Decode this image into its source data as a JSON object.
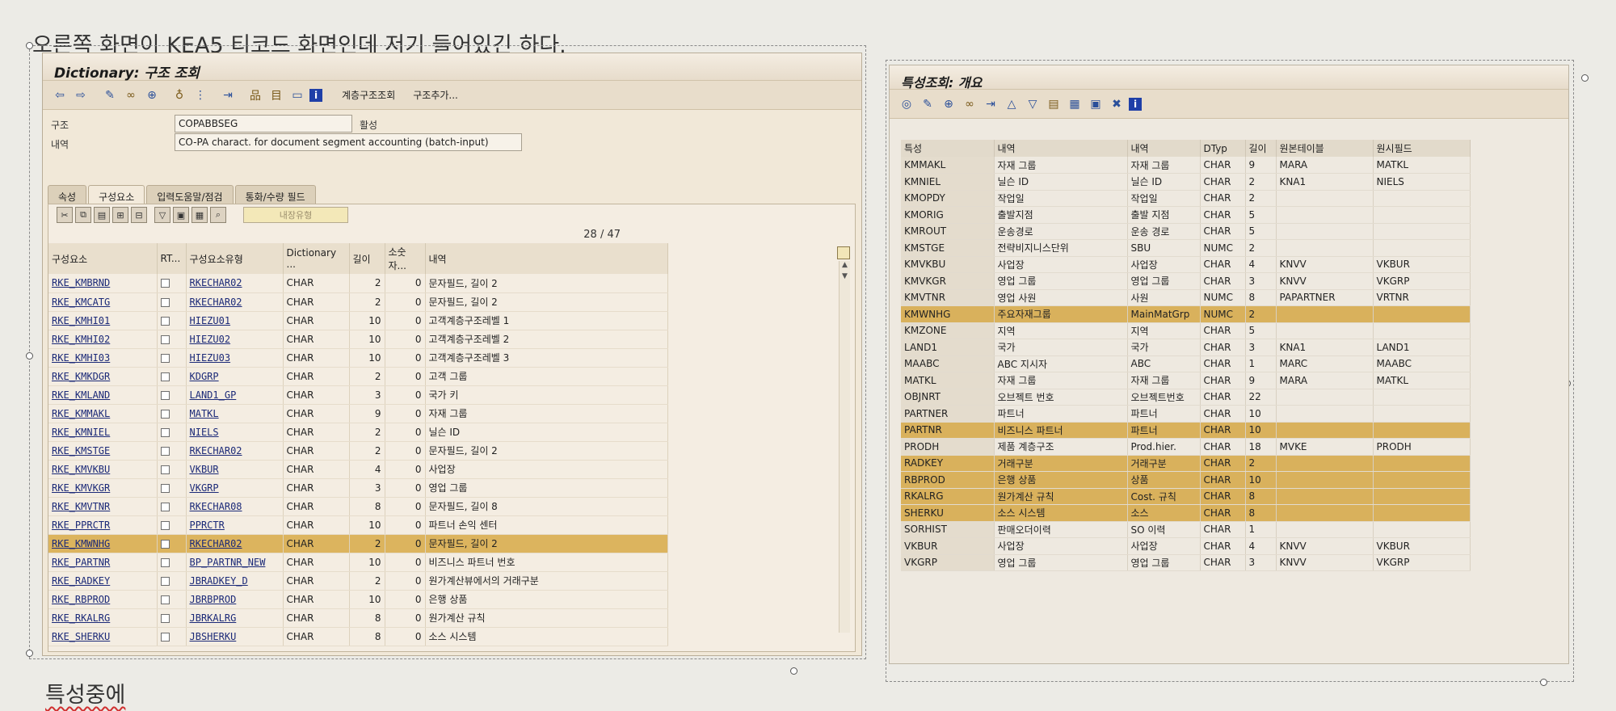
{
  "doc": {
    "top_note": "오른쪽 화면이 KEA5 티코드 화면인데 저기 들어있긴 하다.",
    "bottom_note": "특성중에"
  },
  "left": {
    "title": "Dictionary: 구조 조회",
    "toolbar_icons": [
      "back-icon",
      "forward-icon",
      "pencil-icon",
      "glasses-icon",
      "display-change-icon",
      "where-used-icon",
      "hierarchy-icon",
      "activate-icon",
      "tree-icon",
      "layout-icon",
      "window-icon",
      "info-icon"
    ],
    "toolbar_text": [
      "계층구조조회",
      "구조추가..."
    ],
    "structure_label": "구조",
    "structure_value": "COPABBSEG",
    "structure_status": "활성",
    "desc_label": "내역",
    "desc_value": "CO-PA charact. for document segment accounting (batch-input)",
    "tabs": [
      "속성",
      "구성요소",
      "입력도움말/점검",
      "통화/수량 필드"
    ],
    "disabled_button": "내장유형",
    "pager": "28 / 47",
    "headers": [
      "구성요소",
      "RT...",
      "구성요소유형",
      "Dictionary ...",
      "길이",
      "소숫자...",
      "내역"
    ],
    "rows": [
      [
        "RKE_KMBRND",
        "RKECHAR02",
        "CHAR",
        "2",
        "0",
        "문자필드, 길이 2"
      ],
      [
        "RKE_KMCATG",
        "RKECHAR02",
        "CHAR",
        "2",
        "0",
        "문자필드, 길이 2"
      ],
      [
        "RKE_KMHI01",
        "HIEZU01",
        "CHAR",
        "10",
        "0",
        "고객계층구조레벨 1"
      ],
      [
        "RKE_KMHI02",
        "HIEZU02",
        "CHAR",
        "10",
        "0",
        "고객계층구조레벨 2"
      ],
      [
        "RKE_KMHI03",
        "HIEZU03",
        "CHAR",
        "10",
        "0",
        "고객계층구조레벨 3"
      ],
      [
        "RKE_KMKDGR",
        "KDGRP",
        "CHAR",
        "2",
        "0",
        "고객 그룹"
      ],
      [
        "RKE_KMLAND",
        "LAND1_GP",
        "CHAR",
        "3",
        "0",
        "국가 키"
      ],
      [
        "RKE_KMMAKL",
        "MATKL",
        "CHAR",
        "9",
        "0",
        "자재 그룹"
      ],
      [
        "RKE_KMNIEL",
        "NIELS",
        "CHAR",
        "2",
        "0",
        "닐슨 ID"
      ],
      [
        "RKE_KMSTGE",
        "RKECHAR02",
        "CHAR",
        "2",
        "0",
        "문자필드, 길이 2"
      ],
      [
        "RKE_KMVKBU",
        "VKBUR",
        "CHAR",
        "4",
        "0",
        "사업장"
      ],
      [
        "RKE_KMVKGR",
        "VKGRP",
        "CHAR",
        "3",
        "0",
        "영업 그룹"
      ],
      [
        "RKE_KMVTNR",
        "RKECHAR08",
        "CHAR",
        "8",
        "0",
        "문자필드, 길이 8"
      ],
      [
        "RKE_PPRCTR",
        "PPRCTR",
        "CHAR",
        "10",
        "0",
        "파트너 손익 센터"
      ],
      [
        "RKE_KMWNHG",
        "RKECHAR02",
        "CHAR",
        "2",
        "0",
        "문자필드, 길이 2"
      ],
      [
        "RKE_PARTNR",
        "BP_PARTNR_NEW",
        "CHAR",
        "10",
        "0",
        "비즈니스 파트너 번호"
      ],
      [
        "RKE_RADKEY",
        "JBRADKEY_D",
        "CHAR",
        "2",
        "0",
        "원가계산뷰에서의 거래구분"
      ],
      [
        "RKE_RBPROD",
        "JBRBPROD",
        "CHAR",
        "10",
        "0",
        "은행 상품"
      ],
      [
        "RKE_RKALRG",
        "JBRKALRG",
        "CHAR",
        "8",
        "0",
        "원가계산 규칙"
      ],
      [
        "RKE_SHERKU",
        "JBSHERKU",
        "CHAR",
        "8",
        "0",
        "소스 시스템"
      ]
    ],
    "highlight_row": 14
  },
  "right": {
    "title": "특성조회: 개요",
    "toolbar_icons": [
      "display-icon",
      "pencil-icon",
      "change-icon",
      "glasses-icon",
      "create-icon",
      "sort-icon",
      "filter-icon",
      "export-icon",
      "layout-icon",
      "grid-icon",
      "delete-icon",
      "info-icon"
    ],
    "headers": [
      "특성",
      "내역",
      "내역",
      "DTyp",
      "길이",
      "원본테이블",
      "원시필드"
    ],
    "rows": [
      [
        "KMMAKL",
        "자재 그룹",
        "자재 그룹",
        "CHAR",
        "9",
        "MARA",
        "MATKL"
      ],
      [
        "KMNIEL",
        "닐슨 ID",
        "닐슨 ID",
        "CHAR",
        "2",
        "KNA1",
        "NIELS"
      ],
      [
        "KMOPDY",
        "작업일",
        "작업일",
        "CHAR",
        "2",
        "",
        ""
      ],
      [
        "KMORIG",
        "출발지점",
        "출발 지점",
        "CHAR",
        "5",
        "",
        ""
      ],
      [
        "KMROUT",
        "운송경로",
        "운송 경로",
        "CHAR",
        "5",
        "",
        ""
      ],
      [
        "KMSTGE",
        "전략비지니스단위",
        "SBU",
        "NUMC",
        "2",
        "",
        ""
      ],
      [
        "KMVKBU",
        "사업장",
        "사업장",
        "CHAR",
        "4",
        "KNVV",
        "VKBUR"
      ],
      [
        "KMVKGR",
        "영업 그룹",
        "영업 그룹",
        "CHAR",
        "3",
        "KNVV",
        "VKGRP"
      ],
      [
        "KMVTNR",
        "영업 사원",
        "사원",
        "NUMC",
        "8",
        "PAPARTNER",
        "VRTNR"
      ],
      [
        "KMWNHG",
        "주요자재그룹",
        "MainMatGrp",
        "NUMC",
        "2",
        "",
        ""
      ],
      [
        "KMZONE",
        "지역",
        "지역",
        "CHAR",
        "5",
        "",
        ""
      ],
      [
        "LAND1",
        "국가",
        "국가",
        "CHAR",
        "3",
        "KNA1",
        "LAND1"
      ],
      [
        "MAABC",
        "ABC 지시자",
        "ABC",
        "CHAR",
        "1",
        "MARC",
        "MAABC"
      ],
      [
        "MATKL",
        "자재 그룹",
        "자재 그룹",
        "CHAR",
        "9",
        "MARA",
        "MATKL"
      ],
      [
        "OBJNRT",
        "오브젝트 번호",
        "오브젝트번호",
        "CHAR",
        "22",
        "",
        ""
      ],
      [
        "PARTNER",
        "파트너",
        "파트너",
        "CHAR",
        "10",
        "",
        ""
      ],
      [
        "PARTNR",
        "비즈니스 파트너",
        "파트너",
        "CHAR",
        "10",
        "",
        ""
      ],
      [
        "PRODH",
        "제품 계층구조",
        "Prod.hier.",
        "CHAR",
        "18",
        "MVKE",
        "PRODH"
      ],
      [
        "RADKEY",
        "거래구분",
        "거래구분",
        "CHAR",
        "2",
        "",
        ""
      ],
      [
        "RBPROD",
        "은행 상품",
        "상품",
        "CHAR",
        "10",
        "",
        ""
      ],
      [
        "RKALRG",
        "원가계산 규칙",
        "Cost. 규칙",
        "CHAR",
        "8",
        "",
        ""
      ],
      [
        "SHERKU",
        "소스 시스템",
        "소스",
        "CHAR",
        "8",
        "",
        ""
      ],
      [
        "SORHIST",
        "판매오더이력",
        "SO 이력",
        "CHAR",
        "1",
        "",
        ""
      ],
      [
        "VKBUR",
        "사업장",
        "사업장",
        "CHAR",
        "4",
        "KNVV",
        "VKBUR"
      ],
      [
        "VKGRP",
        "영업 그룹",
        "영업 그룹",
        "CHAR",
        "3",
        "KNVV",
        "VKGRP"
      ]
    ],
    "highlight_rows": [
      9,
      16,
      18,
      19,
      20,
      21
    ]
  }
}
